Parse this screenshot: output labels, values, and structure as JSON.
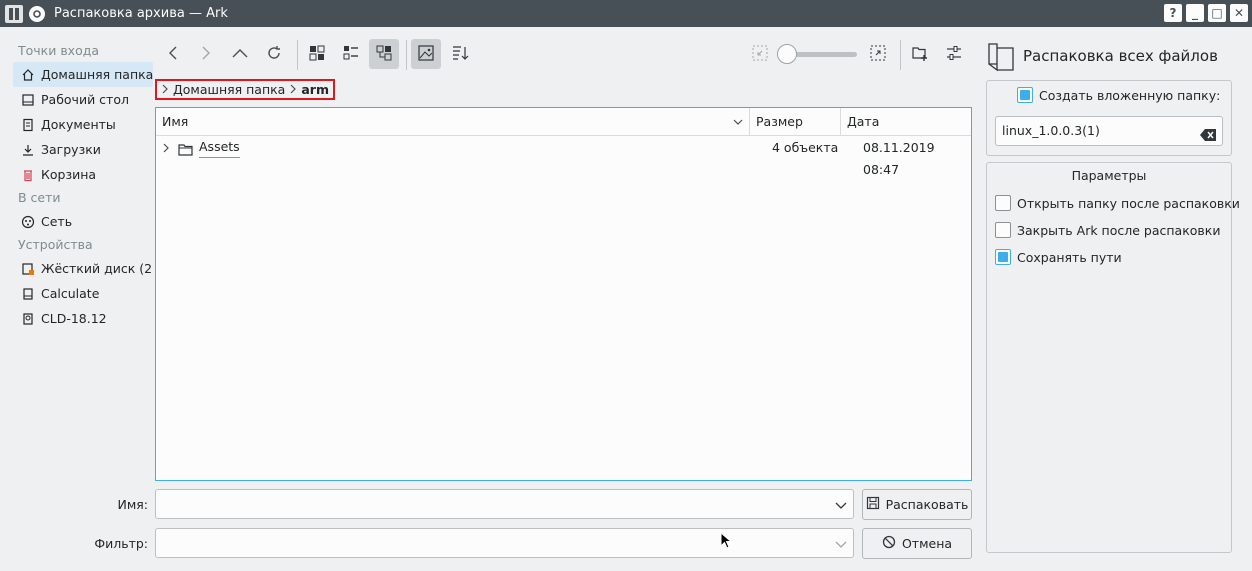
{
  "window": {
    "title": "Распаковка архива — Ark",
    "buttons": [
      "?",
      "_",
      "□",
      "✕"
    ]
  },
  "sidebar": {
    "sections": [
      {
        "heading": "Точки входа",
        "items": [
          {
            "label": "Домашняя папка",
            "icon": "home-icon",
            "selected": true
          },
          {
            "label": "Рабочий стол",
            "icon": "desktop-icon"
          },
          {
            "label": "Документы",
            "icon": "documents-icon"
          },
          {
            "label": "Загрузки",
            "icon": "downloads-icon"
          },
          {
            "label": "Корзина",
            "icon": "trash-icon"
          }
        ]
      },
      {
        "heading": "В сети",
        "items": [
          {
            "label": "Сеть",
            "icon": "network-icon"
          }
        ]
      },
      {
        "heading": "Устройства",
        "items": [
          {
            "label": "Жёсткий диск (2...",
            "icon": "harddisk-icon"
          },
          {
            "label": "Calculate",
            "icon": "drive-icon"
          },
          {
            "label": "CLD-18.12",
            "icon": "optical-disc-icon"
          }
        ]
      }
    ]
  },
  "toolbar": {
    "icons": [
      "back-icon",
      "forward-icon",
      "up-icon",
      "reload-icon",
      "icon-view-icon",
      "compact-view-icon",
      "tree-view-icon",
      "preview-icon",
      "sort-icon",
      "zoom-out-icon",
      "zoom-in-icon",
      "new-folder-icon",
      "options-icon"
    ],
    "active": [
      "tree-view-icon",
      "preview-icon"
    ]
  },
  "breadcrumb": {
    "parent": "Домашняя папка",
    "current": "arm"
  },
  "fileview": {
    "columns": {
      "name": "Имя",
      "size": "Размер",
      "date": "Дата"
    },
    "rows": [
      {
        "name": "Assets",
        "size": "4 объекта",
        "date": "08.11.2019 08:47"
      }
    ]
  },
  "bottom": {
    "name_label": "Имя:",
    "name_value": "",
    "filter_label": "Фильтр:",
    "filter_value": "",
    "extract_button": "Распаковать",
    "cancel_button": "Отмена"
  },
  "right_panel": {
    "title": "Распаковка всех файлов",
    "create_subfolder_label": "Создать вложенную папку:",
    "create_subfolder_checked": true,
    "subfolder_value": "linux_1.0.0.3(1)",
    "params_title": "Параметры",
    "options": [
      {
        "label": "Открыть папку после распаковки",
        "checked": false
      },
      {
        "label": "Закрыть Ark после распаковки",
        "checked": false
      },
      {
        "label": "Сохранять пути",
        "checked": true
      }
    ]
  },
  "colors": {
    "accent": "#3daee9",
    "titlebar": "#475057",
    "highlight_border": "#e0161c"
  }
}
